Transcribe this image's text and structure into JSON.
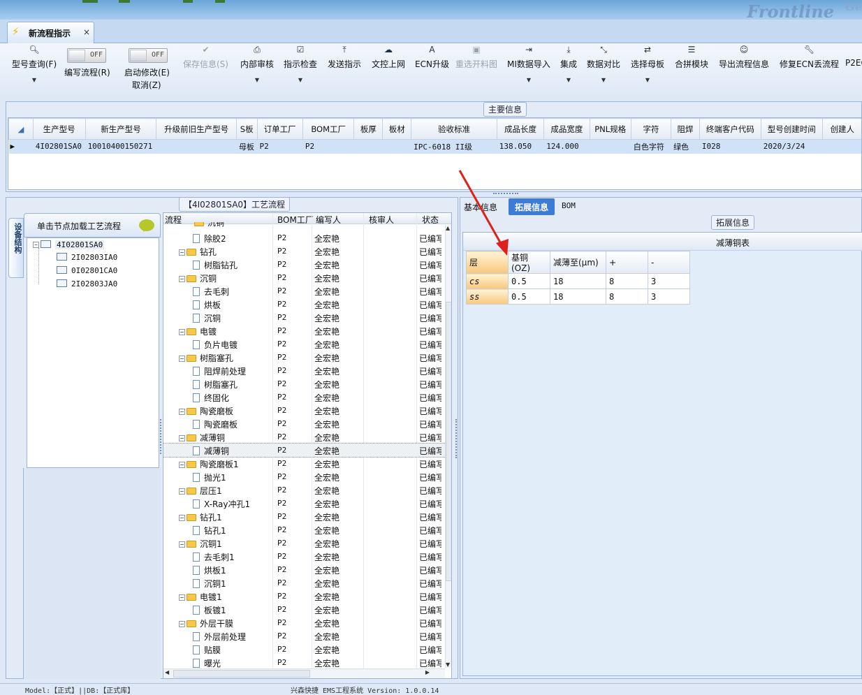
{
  "tabs": [
    {
      "label": "新流程指示",
      "close": "×"
    }
  ],
  "toolbar": {
    "query": {
      "label": "型号查询(F)"
    },
    "write_flow": {
      "label": "编写流程(R)",
      "toggle": "OFF"
    },
    "auto_modify": {
      "label": "启动修改(E)",
      "sub": "取消(Z)",
      "toggle": "OFF"
    },
    "save": {
      "label": "保存信息(S)"
    },
    "internal_review": {
      "label": "内部审核"
    },
    "instr_check": {
      "label": "指示检查"
    },
    "send": {
      "label": "发送指示"
    },
    "upload": {
      "label": "文控上网"
    },
    "ecn": {
      "label": "ECN升级"
    },
    "reselect": {
      "label": "重选开料图"
    },
    "mi_import": {
      "label": "MI数据导入"
    },
    "integrate": {
      "label": "集成"
    },
    "compare": {
      "label": "数据对比"
    },
    "parent": {
      "label": "选择母板"
    },
    "merge": {
      "label": "合拼模块"
    },
    "export": {
      "label": "导出流程信息"
    },
    "fix_ecn": {
      "label": "修复ECN丢流程"
    },
    "p2e": {
      "label": "P2EC"
    }
  },
  "main_info": {
    "title": "主要信息",
    "columns": [
      "生产型号",
      "新生产型号",
      "升级前旧生产型号",
      "S板",
      "订单工厂",
      "BOM工厂",
      "板厚",
      "板材",
      "验收标准",
      "成品长度",
      "成品宽度",
      "PNL规格",
      "字符",
      "阻焊",
      "终端客户代码",
      "型号创建时间",
      "创建人"
    ],
    "row": [
      "4I02801SA0",
      "10010400150271",
      "",
      "母板",
      "P2",
      "P2",
      "",
      "",
      "IPC-6018 II级",
      "138.050",
      "124.000",
      "",
      "白色字符",
      "绿色",
      "I028",
      "2020/3/24",
      ""
    ]
  },
  "left_panel": {
    "vertical_tab": "设备结构",
    "header": "单击节点加载工艺流程",
    "root": "4I02801SA0",
    "children": [
      "2I02803IA0",
      "0I02801CA0",
      "2I02803JA0"
    ]
  },
  "process": {
    "title": "【4I02801SA0】工艺流程",
    "columns": {
      "name": "流程",
      "bom": "BOM工厂",
      "writer": "编写人",
      "reviewer": "核审人",
      "status": "状态"
    },
    "top_partial": "沉铜",
    "rows": [
      {
        "type": "child",
        "name": "除胶2",
        "bom": "P2",
        "writer": "全宏艳",
        "status": "已编写"
      },
      {
        "type": "folder",
        "name": "钻孔",
        "bom": "P2",
        "writer": "全宏艳",
        "status": "已编写"
      },
      {
        "type": "child",
        "name": "树脂钻孔",
        "bom": "P2",
        "writer": "全宏艳",
        "status": "已编写"
      },
      {
        "type": "folder",
        "name": "沉铜",
        "bom": "P2",
        "writer": "全宏艳",
        "status": "已编写"
      },
      {
        "type": "child",
        "name": "去毛刺",
        "bom": "P2",
        "writer": "全宏艳",
        "status": "已编写"
      },
      {
        "type": "child",
        "name": "烘板",
        "bom": "P2",
        "writer": "全宏艳",
        "status": "已编写"
      },
      {
        "type": "child",
        "name": "沉铜",
        "bom": "P2",
        "writer": "全宏艳",
        "status": "已编写"
      },
      {
        "type": "folder",
        "name": "电镀",
        "bom": "P2",
        "writer": "全宏艳",
        "status": "已编写"
      },
      {
        "type": "child",
        "name": "负片电镀",
        "bom": "P2",
        "writer": "全宏艳",
        "status": "已编写"
      },
      {
        "type": "folder",
        "name": "树脂塞孔",
        "bom": "P2",
        "writer": "全宏艳",
        "status": "已编写"
      },
      {
        "type": "child",
        "name": "阻焊前处理",
        "bom": "P2",
        "writer": "全宏艳",
        "status": "已编写"
      },
      {
        "type": "child",
        "name": "树脂塞孔",
        "bom": "P2",
        "writer": "全宏艳",
        "status": "已编写"
      },
      {
        "type": "child",
        "name": "终固化",
        "bom": "P2",
        "writer": "全宏艳",
        "status": "已编写"
      },
      {
        "type": "folder",
        "name": "陶瓷磨板",
        "bom": "P2",
        "writer": "全宏艳",
        "status": "已编写"
      },
      {
        "type": "child",
        "name": "陶瓷磨板",
        "bom": "P2",
        "writer": "全宏艳",
        "status": "已编写"
      },
      {
        "type": "folder",
        "name": "减薄铜",
        "bom": "P2",
        "writer": "全宏艳",
        "status": "已编写"
      },
      {
        "type": "child",
        "name": "减薄铜",
        "bom": "P2",
        "writer": "全宏艳",
        "status": "已编写",
        "selected": true
      },
      {
        "type": "folder",
        "name": "陶瓷磨板1",
        "bom": "P2",
        "writer": "全宏艳",
        "status": "已编写"
      },
      {
        "type": "child",
        "name": "抛光1",
        "bom": "P2",
        "writer": "全宏艳",
        "status": "已编写"
      },
      {
        "type": "folder",
        "name": "层压1",
        "bom": "P2",
        "writer": "全宏艳",
        "status": "已编写"
      },
      {
        "type": "child",
        "name": "X-Ray冲孔1",
        "bom": "P2",
        "writer": "全宏艳",
        "status": "已编写"
      },
      {
        "type": "folder",
        "name": "钻孔1",
        "bom": "P2",
        "writer": "全宏艳",
        "status": "已编写"
      },
      {
        "type": "child",
        "name": "钻孔1",
        "bom": "P2",
        "writer": "全宏艳",
        "status": "已编写"
      },
      {
        "type": "folder",
        "name": "沉铜1",
        "bom": "P2",
        "writer": "全宏艳",
        "status": "已编写"
      },
      {
        "type": "child",
        "name": "去毛刺1",
        "bom": "P2",
        "writer": "全宏艳",
        "status": "已编写"
      },
      {
        "type": "child",
        "name": "烘板1",
        "bom": "P2",
        "writer": "全宏艳",
        "status": "已编写"
      },
      {
        "type": "child",
        "name": "沉铜1",
        "bom": "P2",
        "writer": "全宏艳",
        "status": "已编写"
      },
      {
        "type": "folder",
        "name": "电镀1",
        "bom": "P2",
        "writer": "全宏艳",
        "status": "已编写"
      },
      {
        "type": "child",
        "name": "板镀1",
        "bom": "P2",
        "writer": "全宏艳",
        "status": "已编写"
      },
      {
        "type": "folder",
        "name": "外层干膜",
        "bom": "P2",
        "writer": "全宏艳",
        "status": "已编写"
      },
      {
        "type": "child",
        "name": "外层前处理",
        "bom": "P2",
        "writer": "全宏艳",
        "status": "已编写"
      },
      {
        "type": "child",
        "name": "贴膜",
        "bom": "P2",
        "writer": "全宏艳",
        "status": "已编写"
      },
      {
        "type": "child",
        "name": "曝光",
        "bom": "P2",
        "writer": "全宏艳",
        "status": "已编写"
      }
    ]
  },
  "right_panel": {
    "tabs": [
      "基本信息",
      "拓展信息",
      "BOM"
    ],
    "group": "拓展信息",
    "table_title": "减薄铜表",
    "columns": [
      "层",
      "基铜(OZ)",
      "减薄至(μm)",
      "+",
      "-"
    ],
    "rows": [
      [
        "cs",
        "0.5",
        "18",
        "8",
        "3"
      ],
      [
        "ss",
        "0.5",
        "18",
        "8",
        "3"
      ]
    ]
  },
  "status_bar": {
    "left": "Model:【正式】||DB:【正式库】",
    "center": "兴森快捷 EMS工程系统 Version: 1.0.0.14"
  }
}
